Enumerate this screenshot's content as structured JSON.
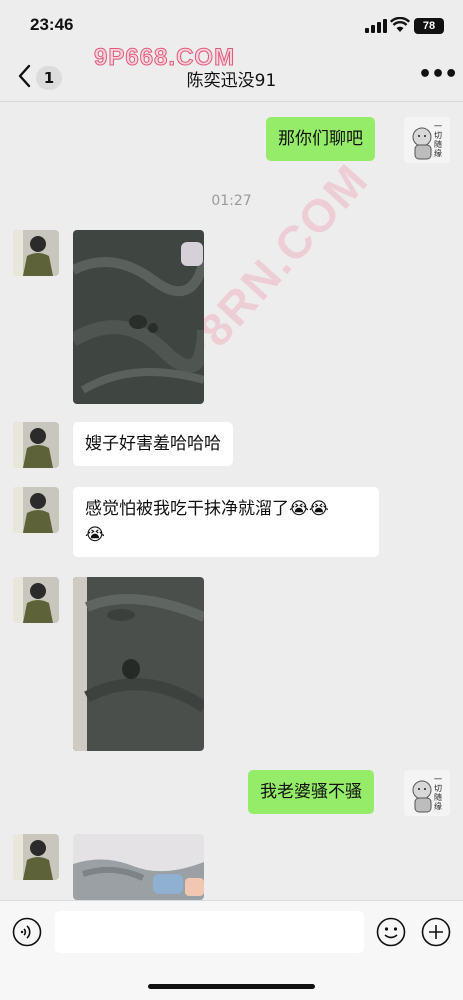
{
  "status_bar": {
    "time": "23:46",
    "battery": "78"
  },
  "nav": {
    "unread_count": "1",
    "title": "陈奕迅没91"
  },
  "watermark": {
    "top_text": "9P668.COM",
    "diagonal_text": "9P8RN.COM"
  },
  "timestamp": "01:27",
  "messages": {
    "m1": {
      "sender": "me",
      "text": "那你们聊吧"
    },
    "m2": {
      "sender": "them",
      "type": "image"
    },
    "m3": {
      "sender": "them",
      "text": "嫂子好害羞哈哈哈"
    },
    "m4": {
      "sender": "them",
      "text_line1": "感觉怕被我吃干抹净就溜了😭😭",
      "text_line2": "😭"
    },
    "m5": {
      "sender": "them",
      "type": "image"
    },
    "m6": {
      "sender": "me",
      "text": "我老婆骚不骚"
    },
    "m7": {
      "sender": "them",
      "type": "image"
    }
  },
  "sticker_avatar_text": "一切随缘",
  "input": {
    "placeholder": ""
  },
  "icons": {
    "back": "back-chevron-icon",
    "more": "more-icon",
    "voice": "voice-icon",
    "emoji": "emoji-icon",
    "plus": "plus-icon"
  },
  "colors": {
    "my_bubble": "#95ec69",
    "their_bubble": "#ffffff",
    "background": "#ededed"
  }
}
